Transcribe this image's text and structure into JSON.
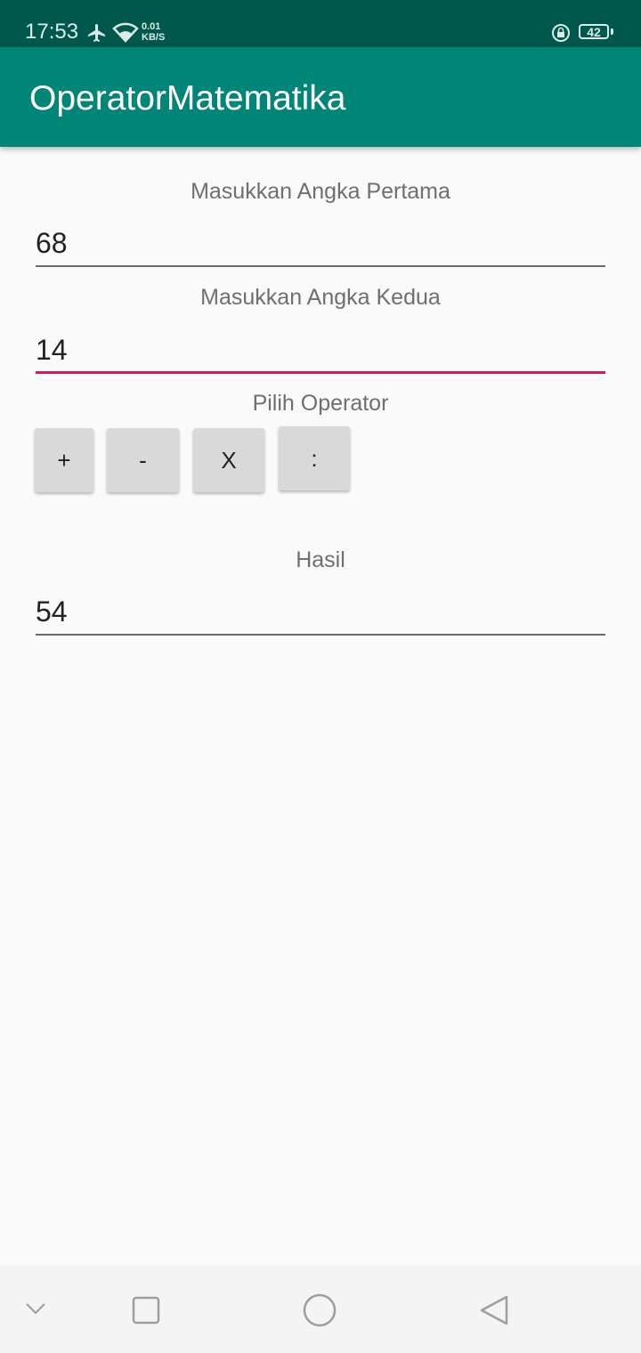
{
  "status_bar": {
    "time": "17:53",
    "net_speed_value": "0.01",
    "net_speed_unit": "KB/S",
    "battery_level": "42",
    "icons": [
      "airplane-icon",
      "wifi-icon",
      "rotation-lock-icon",
      "battery-icon"
    ]
  },
  "app_bar": {
    "title": "OperatorMatematika",
    "color": "#008577"
  },
  "form": {
    "first_label": "Masukkan Angka Pertama",
    "first_value": "68",
    "second_label": "Masukkan Angka Kedua",
    "second_value": "14",
    "operator_label": "Pilih Operator",
    "operators": [
      "+",
      "-",
      "X",
      ":"
    ],
    "result_label": "Hasil",
    "result_value": "54"
  },
  "colors": {
    "accent": "#d81b60",
    "primary_dark": "#00574b"
  },
  "nav_bar": {
    "icons": [
      "chevron-down-icon",
      "recents-icon",
      "home-icon",
      "back-icon"
    ]
  }
}
